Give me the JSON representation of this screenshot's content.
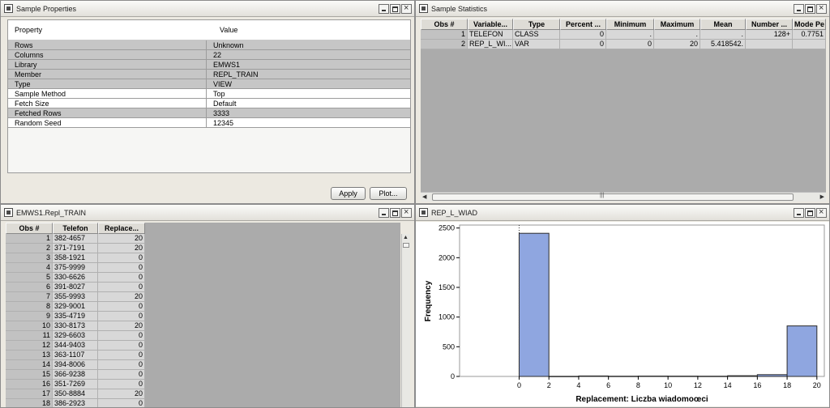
{
  "sample_properties": {
    "title": "Sample Properties",
    "header": {
      "property": "Property",
      "value": "Value"
    },
    "rows": [
      {
        "property": "Rows",
        "value": "Unknown",
        "editable": false
      },
      {
        "property": "Columns",
        "value": "22",
        "editable": false
      },
      {
        "property": "Library",
        "value": "EMWS1",
        "editable": false
      },
      {
        "property": "Member",
        "value": "REPL_TRAIN",
        "editable": false
      },
      {
        "property": "Type",
        "value": "VIEW",
        "editable": false
      },
      {
        "property": "Sample Method",
        "value": "Top",
        "editable": true
      },
      {
        "property": "Fetch Size",
        "value": "Default",
        "editable": true
      },
      {
        "property": "Fetched Rows",
        "value": "3333",
        "editable": false
      },
      {
        "property": "Random Seed",
        "value": "12345",
        "editable": true
      }
    ],
    "apply_label": "Apply",
    "plot_label": "Plot..."
  },
  "sample_statistics": {
    "title": "Sample Statistics",
    "columns": [
      "Obs #",
      "Variable...",
      "Type",
      "Percent ...",
      "Minimum",
      "Maximum",
      "Mean",
      "Number ...",
      "Mode Pe"
    ],
    "rows": [
      [
        "1",
        "TELEFON",
        "CLASS",
        "0",
        ".",
        ".",
        ".",
        "128+",
        "0.7751"
      ],
      [
        "2",
        "REP_L_WI...",
        "VAR",
        "0",
        "0",
        "20",
        "5.418542.",
        "",
        ""
      ]
    ],
    "scroll_mark": "|||"
  },
  "table_view": {
    "title": "EMWS1.Repl_TRAIN",
    "columns": [
      "Obs #",
      "Telefon",
      "Replace..."
    ],
    "rows": [
      [
        "1",
        "382-4657",
        "20"
      ],
      [
        "2",
        "371-7191",
        "20"
      ],
      [
        "3",
        "358-1921",
        "0"
      ],
      [
        "4",
        "375-9999",
        "0"
      ],
      [
        "5",
        "330-6626",
        "0"
      ],
      [
        "6",
        "391-8027",
        "0"
      ],
      [
        "7",
        "355-9993",
        "20"
      ],
      [
        "8",
        "329-9001",
        "0"
      ],
      [
        "9",
        "335-4719",
        "0"
      ],
      [
        "10",
        "330-8173",
        "20"
      ],
      [
        "11",
        "329-6603",
        "0"
      ],
      [
        "12",
        "344-9403",
        "0"
      ],
      [
        "13",
        "363-1107",
        "0"
      ],
      [
        "14",
        "394-8006",
        "0"
      ],
      [
        "15",
        "366-9238",
        "0"
      ],
      [
        "16",
        "351-7269",
        "0"
      ],
      [
        "17",
        "350-8884",
        "20"
      ],
      [
        "18",
        "386-2923",
        "0"
      ]
    ]
  },
  "histogram": {
    "title": "REP_L_WIAD",
    "colors": {
      "bar": "#8fa6e0",
      "bar_edge": "#2b2b2b",
      "background": "#ffffff"
    }
  },
  "chart_data": {
    "type": "bar",
    "title": "",
    "xlabel": "Replacement: Liczba wiadomoœci",
    "ylabel": "Frequency",
    "xlim": [
      -4,
      20.5
    ],
    "ylim": [
      0,
      2550
    ],
    "xticks": [
      0,
      2,
      4,
      6,
      8,
      10,
      12,
      14,
      16,
      18,
      20
    ],
    "yticks": [
      0,
      500,
      1000,
      1500,
      2000,
      2500
    ],
    "bins": [
      {
        "x0": 0,
        "x1": 2,
        "value": 2411
      },
      {
        "x0": 2,
        "x1": 4,
        "value": 2
      },
      {
        "x0": 4,
        "x1": 6,
        "value": 8
      },
      {
        "x0": 6,
        "x1": 8,
        "value": 4
      },
      {
        "x0": 8,
        "x1": 10,
        "value": 6
      },
      {
        "x0": 10,
        "x1": 12,
        "value": 5
      },
      {
        "x0": 12,
        "x1": 14,
        "value": 4
      },
      {
        "x0": 14,
        "x1": 16,
        "value": 12
      },
      {
        "x0": 16,
        "x1": 18,
        "value": 30
      },
      {
        "x0": 18,
        "x1": 20,
        "value": 851
      }
    ],
    "reference_line_x": 0,
    "grid": false,
    "legend": "none"
  }
}
